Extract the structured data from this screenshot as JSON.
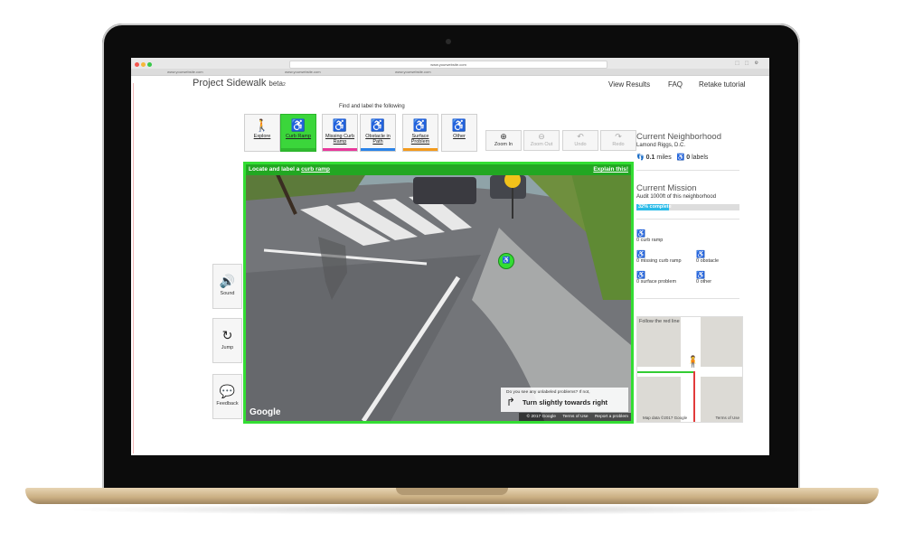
{
  "browser": {
    "address": "www.yourwebsite.com",
    "tabs": [
      "www.yourwebsite.com",
      "www.yourwebsite.com",
      "www.yourwebsite.com"
    ]
  },
  "header": {
    "brand": "Project Sidewalk",
    "beta": "beta",
    "beta_sub": "2",
    "nav": [
      "View Results",
      "FAQ",
      "Retake tutorial"
    ]
  },
  "toolbar": {
    "title": "Find and label the following",
    "tools": [
      {
        "label": "Explore",
        "icon": "walking-person-icon",
        "glyph": "🚶",
        "bar": ""
      },
      {
        "label": "Curb Ramp",
        "icon": "curb-ramp-icon",
        "glyph": "♿",
        "bar": "#2fb82f"
      },
      {
        "label": "Missing Curb Ramp",
        "icon": "missing-curb-ramp-icon",
        "glyph": "♿",
        "bar": "#e8389b"
      },
      {
        "label": "Obstacle in Path",
        "icon": "obstacle-icon",
        "glyph": "♿",
        "bar": "#2b83e8"
      },
      {
        "label": "Surface Problem",
        "icon": "surface-problem-icon",
        "glyph": "♿",
        "bar": "#f39a1c"
      },
      {
        "label": "Other",
        "icon": "other-icon",
        "glyph": "♿",
        "bar": ""
      }
    ],
    "controls": [
      {
        "label": "Zoom In",
        "glyph": "⊕"
      },
      {
        "label": "Zoom Out",
        "glyph": "⊖"
      },
      {
        "label": "Undo",
        "glyph": "↶"
      },
      {
        "label": "Redo",
        "glyph": "↷"
      }
    ]
  },
  "sidebar": {
    "buttons": [
      {
        "label": "Sound",
        "glyph": "🔊"
      },
      {
        "label": "Jump",
        "glyph": "↻"
      },
      {
        "label": "Feedback",
        "glyph": "💬"
      }
    ]
  },
  "streetview": {
    "instruction_prefix": "Locate and label a",
    "instruction_link": "curb ramp",
    "explain": "Explain this!",
    "google": "Google",
    "hint_question": "Do you see any unlabeled problems? If not,",
    "hint_action": "Turn slightly towards right",
    "footer": [
      "© 2017 Google",
      "Terms of Use",
      "Report a problem"
    ]
  },
  "neighborhood": {
    "heading": "Current Neighborhood",
    "name": "Lamond Riggs, D.C.",
    "miles_value": "0.1",
    "miles_unit": "miles",
    "labels_value": "0",
    "labels_unit": "labels"
  },
  "mission": {
    "heading": "Current Mission",
    "description": "Audit 1000ft of this neighborhood",
    "progress_text": "32% complete",
    "progress": 0.32
  },
  "label_counts": {
    "curb_ramp": "0 curb ramp",
    "missing_curb_ramp": "0 missing curb ramp",
    "obstacle": "0 obstacle",
    "surface_problem": "0 surface problem",
    "other": "0 other"
  },
  "map": {
    "hint": "Follow the red line",
    "footer_left": "Map data ©2017 Google",
    "footer_right": "Terms of Use"
  }
}
